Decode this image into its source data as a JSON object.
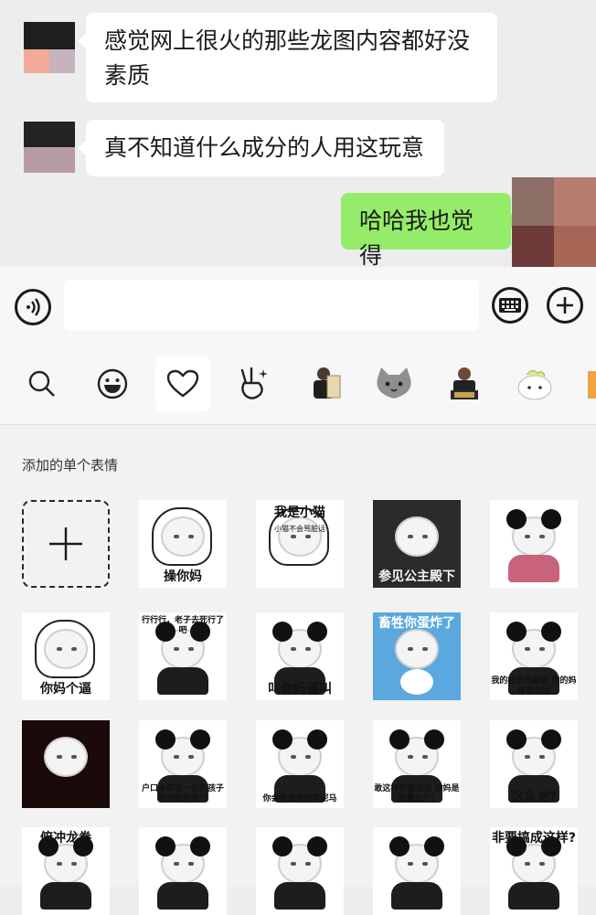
{
  "chat": {
    "messages": [
      {
        "side": "left",
        "text": "感觉网上很火的那些龙图内容都好没素质"
      },
      {
        "side": "left",
        "text": "真不知道什么成分的人用这玩意"
      },
      {
        "side": "right",
        "text": "哈哈我也觉得"
      }
    ]
  },
  "input_bar": {
    "voice_icon": "voice-icon",
    "keyboard_icon": "keyboard-icon",
    "plus_icon": "plus-icon",
    "text_value": ""
  },
  "tabs": [
    "search-icon",
    "smiley-icon",
    "heart-icon",
    "peace-gesture-icon",
    "sticker-pack-1",
    "cat-sticker-pack",
    "sticker-pack-2",
    "cute-sticker-pack"
  ],
  "panel": {
    "section_title": "添加的单个表情",
    "stickers": [
      {
        "caption": "操你妈"
      },
      {
        "caption": "我是小猫",
        "sub": "小猫不会骂脏话"
      },
      {
        "caption": "参见公主殿下"
      },
      {
        "caption": ""
      },
      {
        "caption": "你妈个逼"
      },
      {
        "caption": "行行行，老子去死行了吧"
      },
      {
        "caption": "叫你妈逼叫"
      },
      {
        "caption": "畜牲你蛋炸了"
      },
      {
        "caption": "我的枪去而复返 你的妈有去无回"
      },
      {
        "caption": ""
      },
      {
        "caption": "户口本只有一页的孩子说话就是硬气"
      },
      {
        "caption": "你会失去我的草泥马"
      },
      {
        "caption": "敢这样和我说话 你妈是批量生产?"
      },
      {
        "caption": "这么龙?"
      },
      {
        "caption": "俯冲龙拳"
      },
      {
        "caption": ""
      },
      {
        "caption": ""
      },
      {
        "caption": ""
      },
      {
        "caption": "非要搞成这样?"
      }
    ]
  },
  "colors": {
    "chat_bg": "#ededed",
    "sent_bubble": "#95ec69",
    "received_bubble": "#ffffff",
    "panel_bg": "#f2f2f2"
  }
}
